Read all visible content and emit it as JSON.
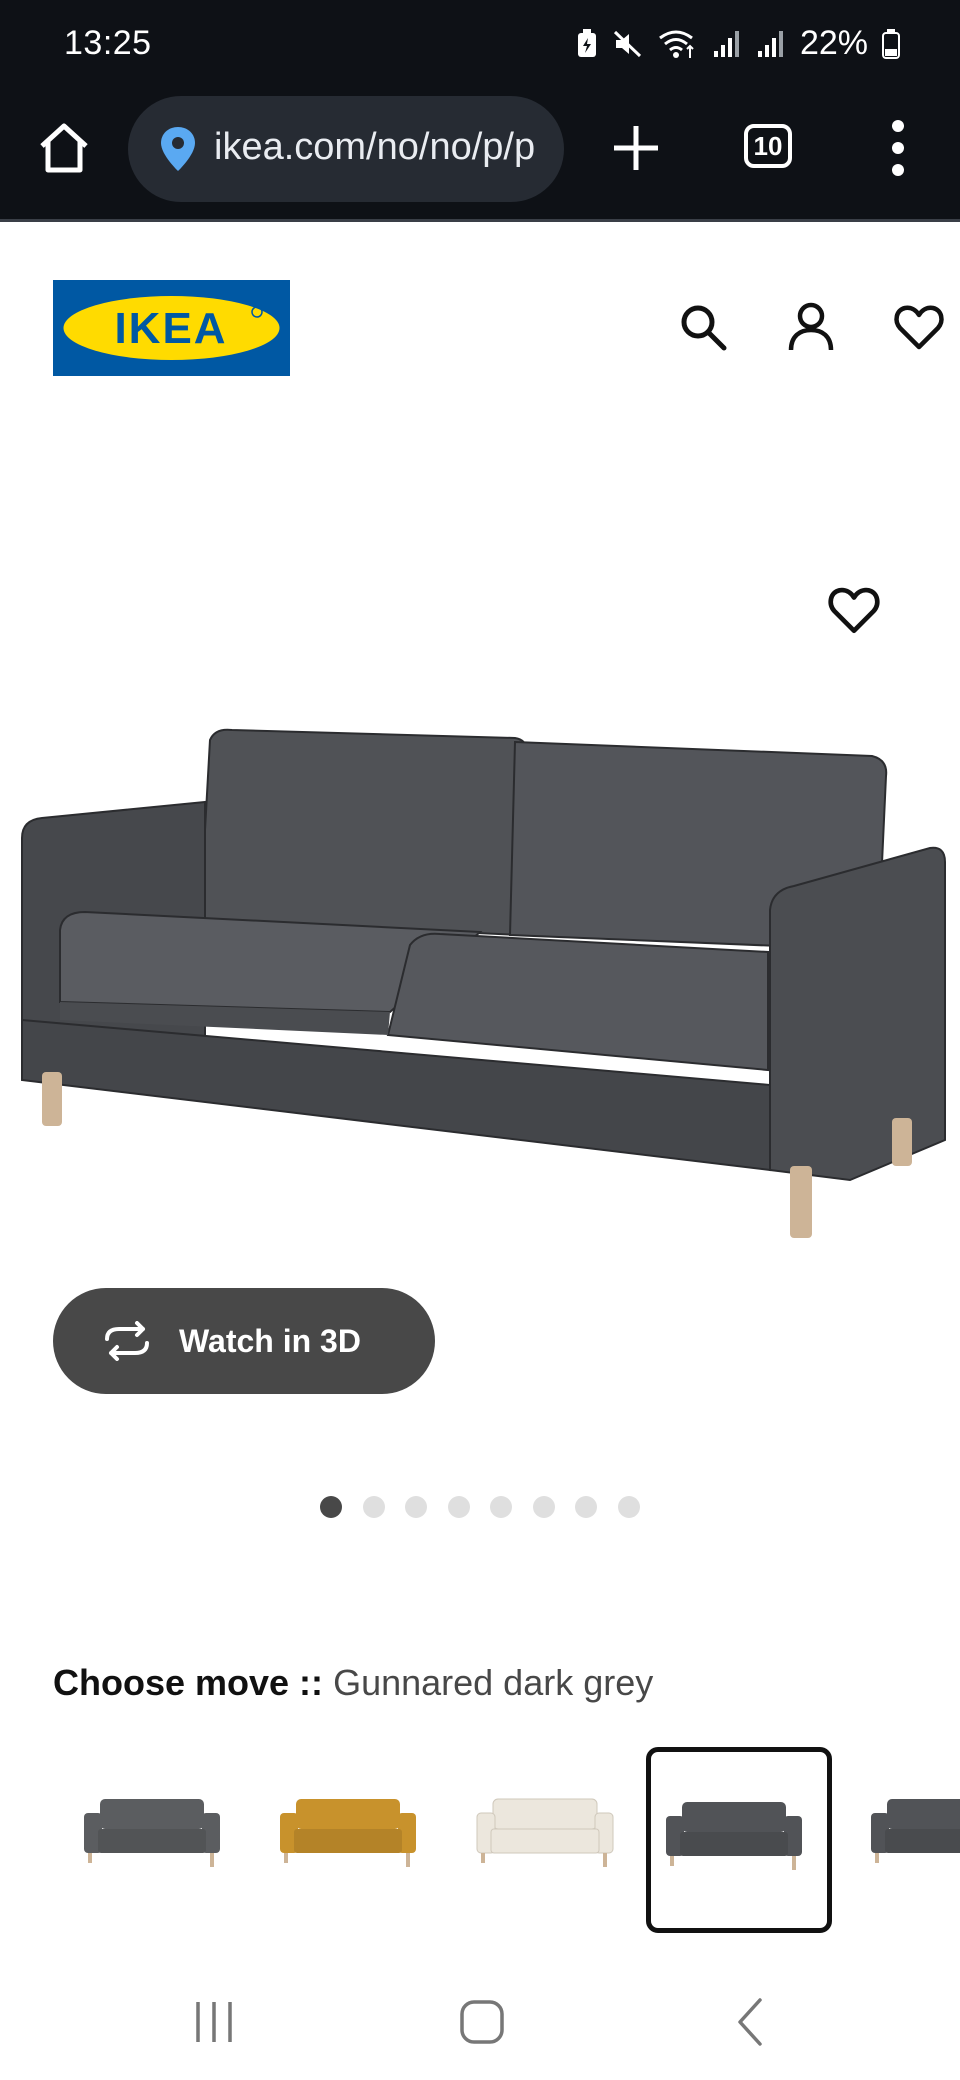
{
  "status_bar": {
    "time": "13:25",
    "battery": "22%"
  },
  "browser": {
    "url": "ikea.com/no/no/p/p",
    "tab_count": "10"
  },
  "site": {
    "logo_text": "IKEA"
  },
  "product": {
    "watch_3d_label": "Watch in 3D",
    "image_count": 8,
    "active_image_index": 0,
    "choose_label": "Choose move ::",
    "choose_value": "Gunnared dark grey",
    "selected_variant_index": 3,
    "variant_colors": [
      "#5b5d60",
      "#c8922c",
      "#ece7dd",
      "#515357",
      "#515357"
    ],
    "main_color": "#4d4f53"
  },
  "icons": {
    "status": [
      "battery-saver-icon",
      "mute-icon",
      "wifi-icon",
      "signal-icon",
      "signal-icon",
      "battery-icon"
    ],
    "header": [
      "search-icon",
      "account-icon",
      "heart-icon"
    ],
    "nav": [
      "recent-apps-icon",
      "home-icon",
      "back-icon"
    ]
  },
  "colors": {
    "ikea_blue": "#0058a3",
    "ikea_yellow": "#ffdb00",
    "dark_button": "#484848"
  }
}
